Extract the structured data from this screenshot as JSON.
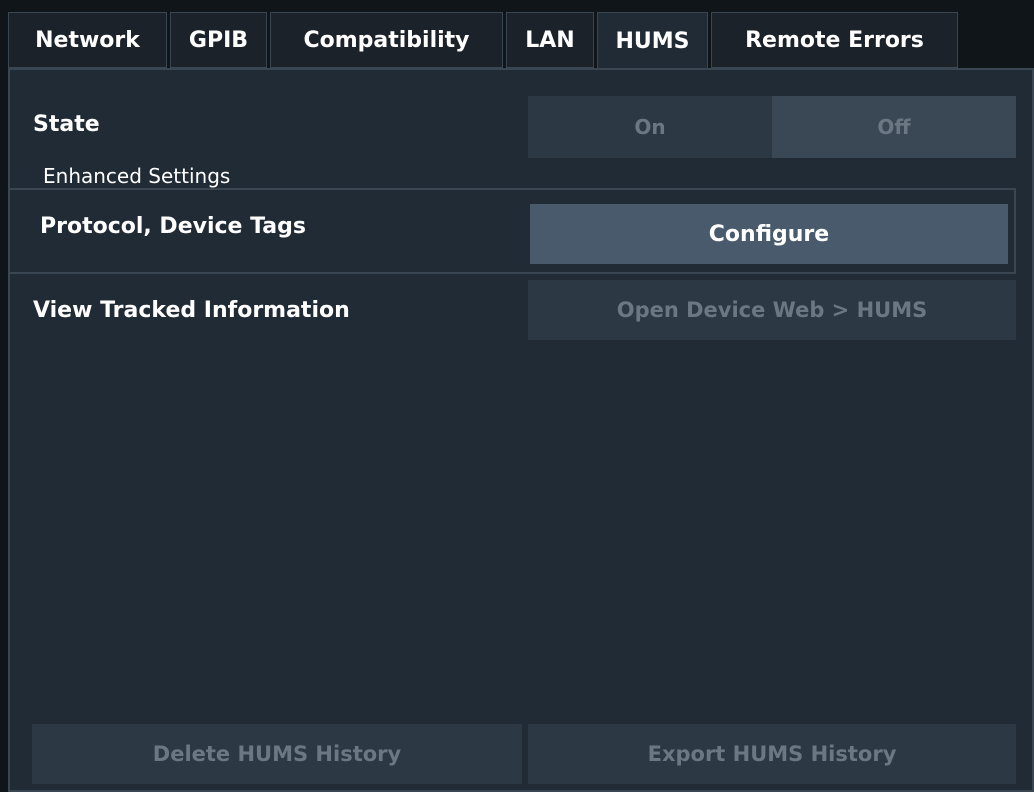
{
  "tabs": [
    {
      "label": "Network"
    },
    {
      "label": "GPIB"
    },
    {
      "label": "Compatibility"
    },
    {
      "label": "LAN"
    },
    {
      "label": "HUMS",
      "active": true
    },
    {
      "label": "Remote Errors"
    }
  ],
  "state": {
    "label": "State",
    "on_label": "On",
    "off_label": "Off",
    "selected": "Off"
  },
  "enhanced": {
    "title": "Enhanced Settings",
    "protocol_label": "Protocol, Device Tags",
    "configure_label": "Configure"
  },
  "tracked": {
    "label": "View Tracked Information",
    "open_web_label": "Open Device Web > HUMS"
  },
  "footer": {
    "delete_label": "Delete HUMS History",
    "export_label": "Export HUMS History"
  }
}
